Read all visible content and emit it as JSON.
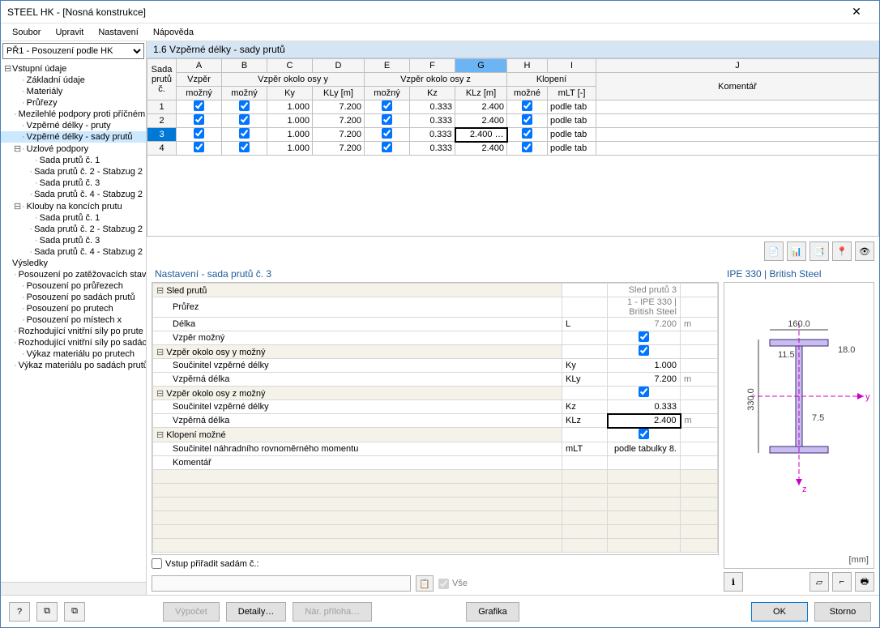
{
  "window": {
    "title": "STEEL HK - [Nosná konstrukce]"
  },
  "menubar": {
    "items": [
      "Soubor",
      "Upravit",
      "Nastavení",
      "Nápověda"
    ]
  },
  "sidebar": {
    "combo": "PŘ1 - Posouzení podle HK",
    "tree": [
      {
        "lvl": 0,
        "txt": "Vstupní údaje",
        "exp": true
      },
      {
        "lvl": 1,
        "txt": "Základní údaje"
      },
      {
        "lvl": 1,
        "txt": "Materiály"
      },
      {
        "lvl": 1,
        "txt": "Průřezy"
      },
      {
        "lvl": 1,
        "txt": "Mezilehlé podpory proti příčném"
      },
      {
        "lvl": 1,
        "txt": "Vzpěrné délky - pruty"
      },
      {
        "lvl": 1,
        "txt": "Vzpěrné délky - sady prutů",
        "sel": true
      },
      {
        "lvl": 1,
        "txt": "Uzlové podpory",
        "exp": true
      },
      {
        "lvl": 2,
        "txt": "Sada prutů č. 1"
      },
      {
        "lvl": 2,
        "txt": "Sada prutů č. 2 - Stabzug 2"
      },
      {
        "lvl": 2,
        "txt": "Sada prutů č. 3"
      },
      {
        "lvl": 2,
        "txt": "Sada prutů č. 4 - Stabzug 2"
      },
      {
        "lvl": 1,
        "txt": "Klouby na koncích prutu",
        "exp": true
      },
      {
        "lvl": 2,
        "txt": "Sada prutů č. 1"
      },
      {
        "lvl": 2,
        "txt": "Sada prutů č. 2 - Stabzug 2"
      },
      {
        "lvl": 2,
        "txt": "Sada prutů č. 3"
      },
      {
        "lvl": 2,
        "txt": "Sada prutů č. 4 - Stabzug 2"
      },
      {
        "lvl": 0,
        "txt": "Výsledky"
      },
      {
        "lvl": 1,
        "txt": "Posouzení po zatěžovacích stav"
      },
      {
        "lvl": 1,
        "txt": "Posouzení po průřezech"
      },
      {
        "lvl": 1,
        "txt": "Posouzení po sadách prutů"
      },
      {
        "lvl": 1,
        "txt": "Posouzení po prutech"
      },
      {
        "lvl": 1,
        "txt": "Posouzení po místech x"
      },
      {
        "lvl": 1,
        "txt": "Rozhodující vnitřní síly po prute"
      },
      {
        "lvl": 1,
        "txt": "Rozhodující vnitřní síly po sadác"
      },
      {
        "lvl": 1,
        "txt": "Výkaz materiálu po prutech"
      },
      {
        "lvl": 1,
        "txt": "Výkaz materiálu po sadách prutů"
      }
    ]
  },
  "main": {
    "section_title": "1.6 Vzpěrné délky - sady prutů",
    "columns_top": [
      "A",
      "B",
      "C",
      "D",
      "E",
      "F",
      "G",
      "H",
      "I",
      "J"
    ],
    "row_header_top": "Sada",
    "row_header_bot": "prutů č.",
    "group_headers": {
      "vzper": "Vzpěr",
      "okolo_y": "Vzpěr okolo osy y",
      "okolo_z": "Vzpěr okolo osy z",
      "klopeni": "Klopení",
      "komentar": "Komentář"
    },
    "sub_headers": {
      "mozny": "možný",
      "Ky": "Ky",
      "KLy": "KLy [m]",
      "Kz": "Kz",
      "KLz": "KLz [m]",
      "mozne": "možné",
      "mLT": "mLT [-]"
    },
    "rows": [
      {
        "n": "1",
        "mA": true,
        "mB": true,
        "Ky": "1.000",
        "KLy": "7.200",
        "mE": true,
        "Kz": "0.333",
        "KLz": "2.400",
        "mH": true,
        "mLT": "podle tab"
      },
      {
        "n": "2",
        "mA": true,
        "mB": true,
        "Ky": "1.000",
        "KLy": "7.200",
        "mE": true,
        "Kz": "0.333",
        "KLz": "2.400",
        "mH": true,
        "mLT": "podle tab"
      },
      {
        "n": "3",
        "mA": true,
        "mB": true,
        "Ky": "1.000",
        "KLy": "7.200",
        "mE": true,
        "Kz": "0.333",
        "KLz": "2.400 …",
        "mH": true,
        "mLT": "podle tab",
        "active": true
      },
      {
        "n": "4",
        "mA": true,
        "mB": true,
        "Ky": "1.000",
        "KLy": "7.200",
        "mE": true,
        "Kz": "0.333",
        "KLz": "2.400",
        "mH": true,
        "mLT": "podle tab"
      }
    ]
  },
  "detail": {
    "title": "Nastavení - sada prutů č. 3",
    "props": [
      {
        "type": "sect",
        "label": "Sled prutů",
        "value": "Sled prutů 3",
        "ro": true
      },
      {
        "type": "row",
        "label": "Průřez",
        "sub": 1,
        "value": "1 - IPE 330 | British Steel",
        "ro": true
      },
      {
        "type": "row",
        "label": "Délka",
        "sub": 1,
        "sym": "L",
        "value": "7.200",
        "unit": "m",
        "ro": true
      },
      {
        "type": "row",
        "label": "Vzpěr možný",
        "sub": 1,
        "check": true
      },
      {
        "type": "sect",
        "label": "Vzpěr okolo osy y možný",
        "check": true
      },
      {
        "type": "row",
        "label": "Součinitel vzpěrné délky",
        "sub": 1,
        "sym": "Ky",
        "value": "1.000"
      },
      {
        "type": "row",
        "label": "Vzpěrná délka",
        "sub": 1,
        "sym": "KLy",
        "value": "7.200",
        "unit": "m"
      },
      {
        "type": "sect",
        "label": "Vzpěr okolo osy z možný",
        "check": true
      },
      {
        "type": "row",
        "label": "Součinitel vzpěrné délky",
        "sub": 1,
        "sym": "Kz",
        "value": "0.333"
      },
      {
        "type": "row",
        "label": "Vzpěrná délka",
        "sub": 1,
        "sym": "KLz",
        "value": "2.400",
        "unit": "m",
        "active": true
      },
      {
        "type": "sect",
        "label": "Klopení možné",
        "check": true
      },
      {
        "type": "row",
        "label": "Součinitel náhradního rovnoměrného momentu",
        "sub": 1,
        "sym": "mLT",
        "value": "podle tabulky 8."
      },
      {
        "type": "row",
        "label": "Komentář",
        "sub": 1,
        "value": ""
      }
    ],
    "assign_label": "Vstup přiřadit sadám č.:",
    "assign_all": "Vše"
  },
  "preview": {
    "title": "IPE 330 | British Steel",
    "dims": {
      "w": "160.0",
      "h": "330.0",
      "tf": "18.0",
      "tw": "7.5",
      "r": "11.5"
    },
    "unit": "[mm]"
  },
  "bottom": {
    "vypocet": "Výpočet",
    "detaily": "Detaily…",
    "priloha": "Nár. příloha…",
    "grafika": "Grafika",
    "ok": "OK",
    "storno": "Storno"
  }
}
